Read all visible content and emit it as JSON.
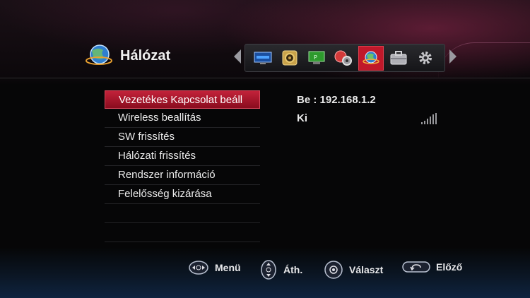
{
  "header": {
    "title": "Hálózat"
  },
  "menu_bar": {
    "icons": [
      "tv-icon",
      "speaker-icon",
      "monitor-icon",
      "media-settings-icon",
      "network-globe-icon",
      "toolbox-icon",
      "gear-icon"
    ],
    "active_index": 4,
    "accent_color": "#c0182a"
  },
  "settings": {
    "items": [
      {
        "label": "Vezetékes Kapcsolat beáll",
        "value": "Be : 192.168.1.2",
        "selected": true
      },
      {
        "label": "Wireless beallítás",
        "value": "Ki"
      },
      {
        "label": "SW frissítés"
      },
      {
        "label": "Hálózati frissítés"
      },
      {
        "label": "Rendszer információ"
      },
      {
        "label": "Felelősség kizárása"
      }
    ]
  },
  "footer": {
    "menu_label": "Menü",
    "move_label": "Áth.",
    "select_label": "Választ",
    "back_label": "Előző"
  }
}
